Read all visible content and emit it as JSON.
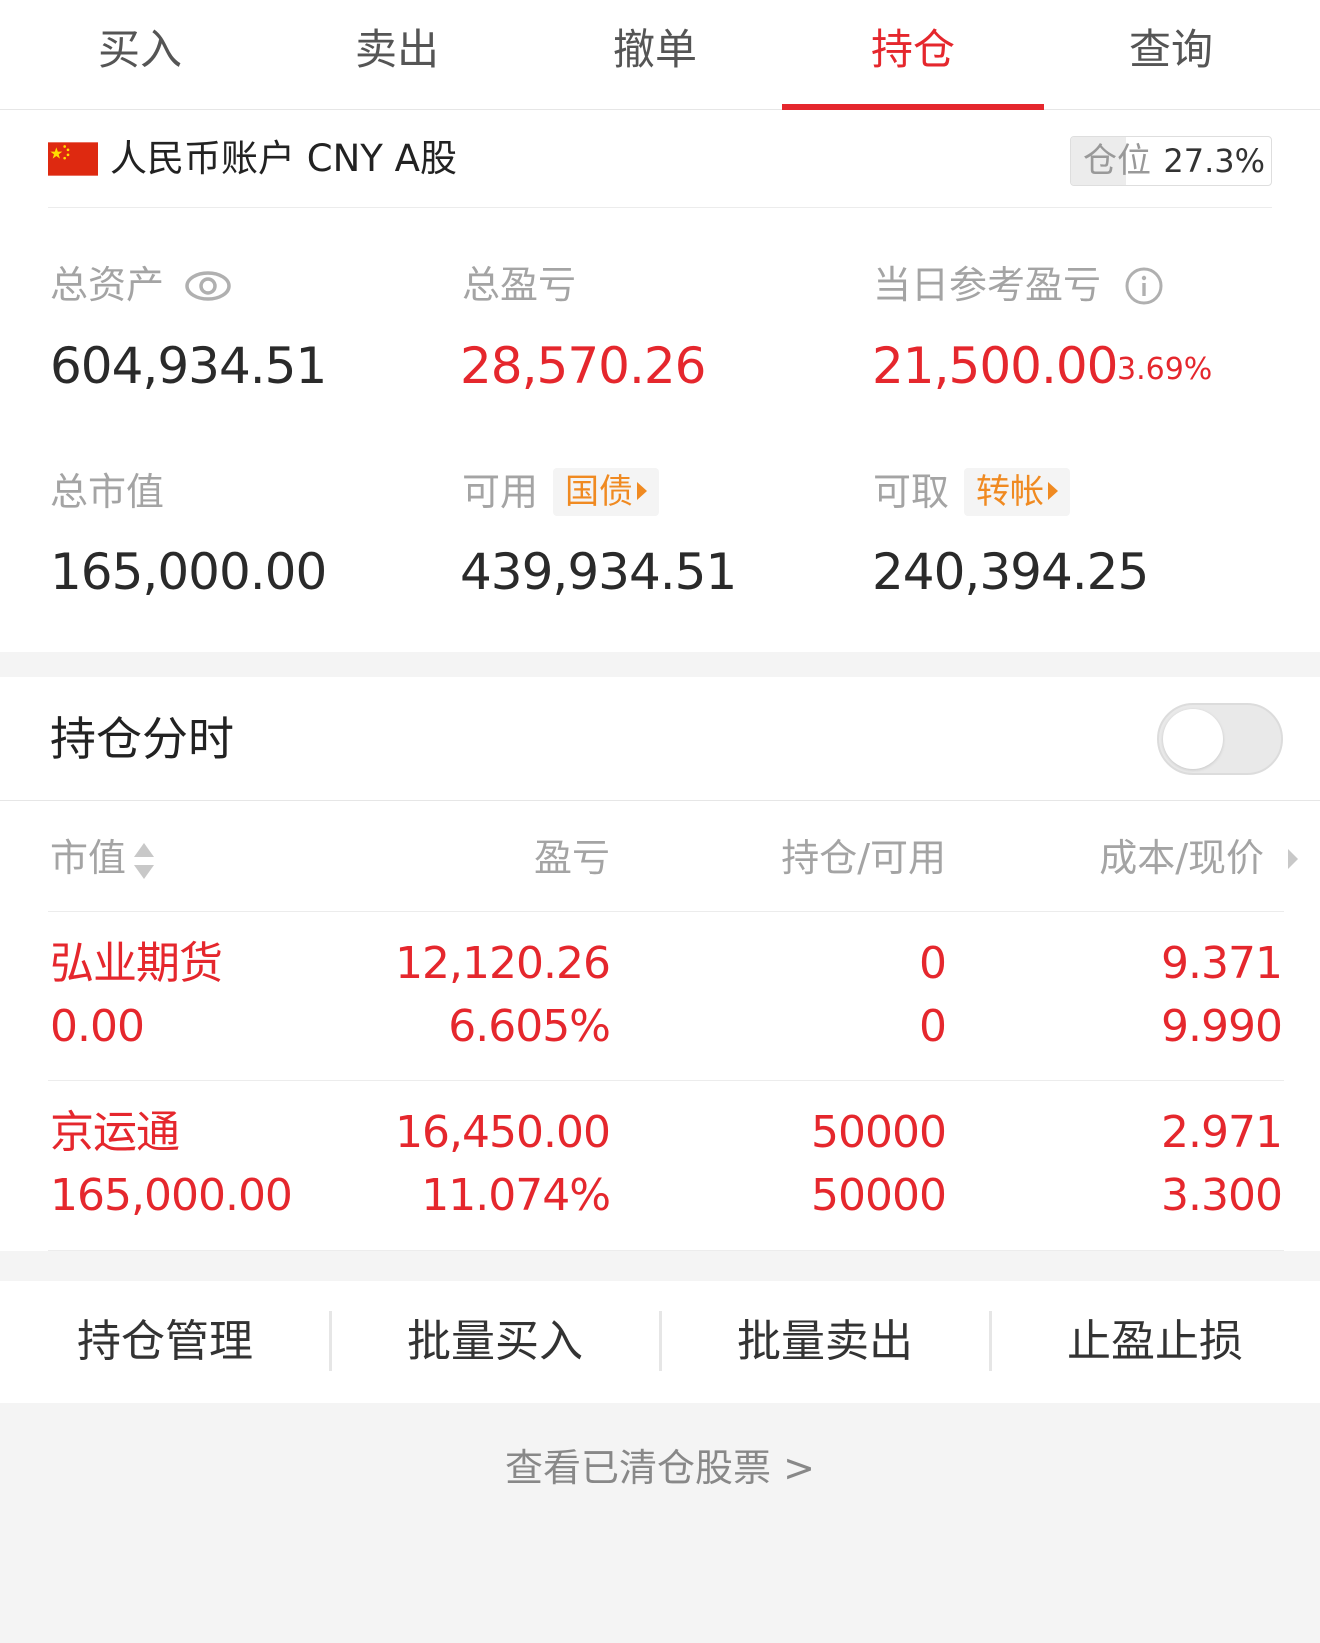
{
  "tabs": [
    {
      "label": "买入"
    },
    {
      "label": "卖出"
    },
    {
      "label": "撤单"
    },
    {
      "label": "持仓"
    },
    {
      "label": "查询"
    }
  ],
  "active_tab": "持仓",
  "account": {
    "name": "人民币账户 CNY A股",
    "position_label": "仓位",
    "position_value": "27.3%",
    "position_fraction": 0.273
  },
  "stats": {
    "total_assets_label": "总资产",
    "total_assets": "604,934.51",
    "total_pnl_label": "总盈亏",
    "total_pnl": "28,570.26",
    "daily_pnl_label": "当日参考盈亏",
    "daily_pnl": "21,500.00",
    "daily_pnl_pct": "3.69%",
    "market_value_label": "总市值",
    "market_value": "165,000.00",
    "available_label": "可用",
    "available_link": "国债",
    "available": "439,934.51",
    "withdrawable_label": "可取",
    "withdrawable_link": "转帐",
    "withdrawable": "240,394.25"
  },
  "timeshare": {
    "title": "持仓分时",
    "enabled": false
  },
  "table": {
    "headers": {
      "market_value": "市值",
      "pnl": "盈亏",
      "position": "持仓/可用",
      "cost": "成本/现价"
    },
    "rows": [
      {
        "name": "弘业期货",
        "market_value": "0.00",
        "pnl": "12,120.26",
        "pnl_pct": "6.605%",
        "position": "0",
        "available": "0",
        "cost": "9.371",
        "price": "9.990"
      },
      {
        "name": "京运通",
        "market_value": "165,000.00",
        "pnl": "16,450.00",
        "pnl_pct": "11.074%",
        "position": "50000",
        "available": "50000",
        "cost": "2.971",
        "price": "3.300"
      }
    ]
  },
  "actions": [
    {
      "label": "持仓管理"
    },
    {
      "label": "批量买入"
    },
    {
      "label": "批量卖出"
    },
    {
      "label": "止盈止损"
    }
  ],
  "cleared_link": "查看已清仓股票 >",
  "colors": {
    "accent_red": "#e5272d",
    "link_orange": "#f08a21",
    "muted_gray": "#a4a4a4"
  },
  "icons": {
    "flag": "china-flag-icon",
    "eye": "eye-icon",
    "info": "info-icon",
    "sort": "sort-icon",
    "chevron": "chevron-right-icon"
  }
}
